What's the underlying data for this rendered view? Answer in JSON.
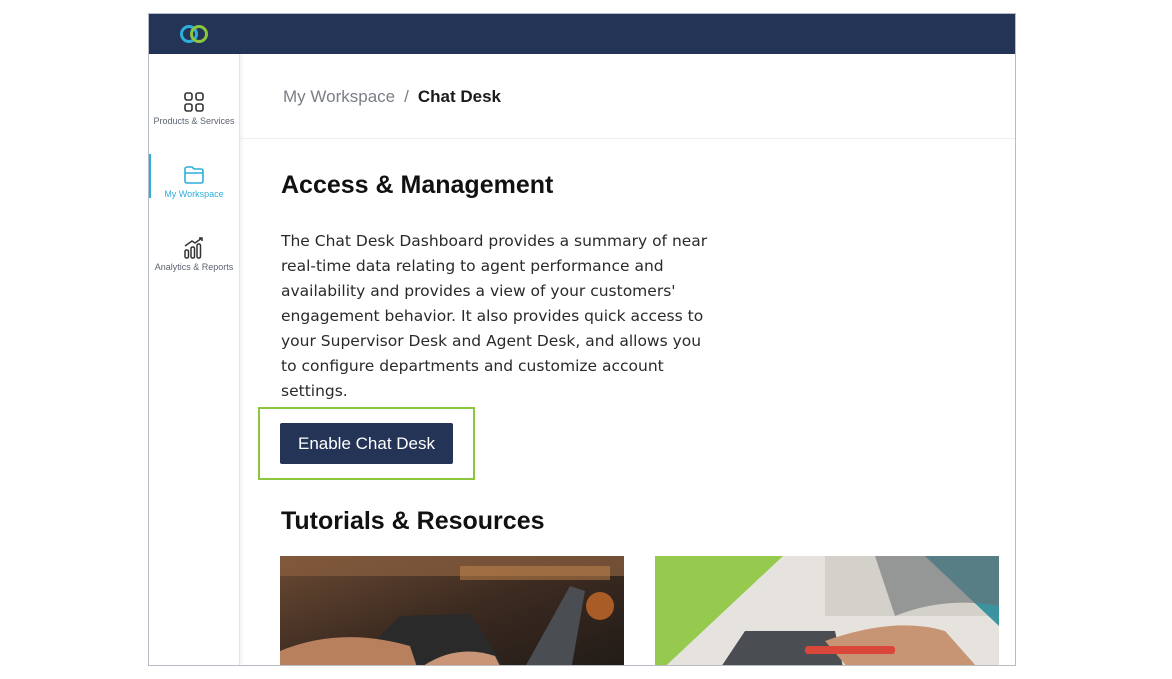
{
  "sidebar": {
    "items": [
      {
        "label": "Products & Services",
        "icon": "grid-icon"
      },
      {
        "label": "My Workspace",
        "icon": "folder-icon",
        "active": true
      },
      {
        "label": "Analytics & Reports",
        "icon": "bar-chart-icon"
      }
    ]
  },
  "breadcrumb": {
    "parent": "My Workspace",
    "separator": "/",
    "current": "Chat Desk"
  },
  "access": {
    "title": "Access & Management",
    "description": "The Chat Desk Dashboard provides a summary of near real-time data relating to agent performance and availability and provides a view of your customers' engagement behavior. It also provides quick access to your Supervisor Desk and Agent Desk, and allows you to configure departments and customize account settings.",
    "button_label": "Enable Chat Desk"
  },
  "tutorials": {
    "title": "Tutorials & Resources"
  },
  "colors": {
    "header": "#233456",
    "accent": "#2eaedb",
    "highlight": "#8cc63f"
  }
}
